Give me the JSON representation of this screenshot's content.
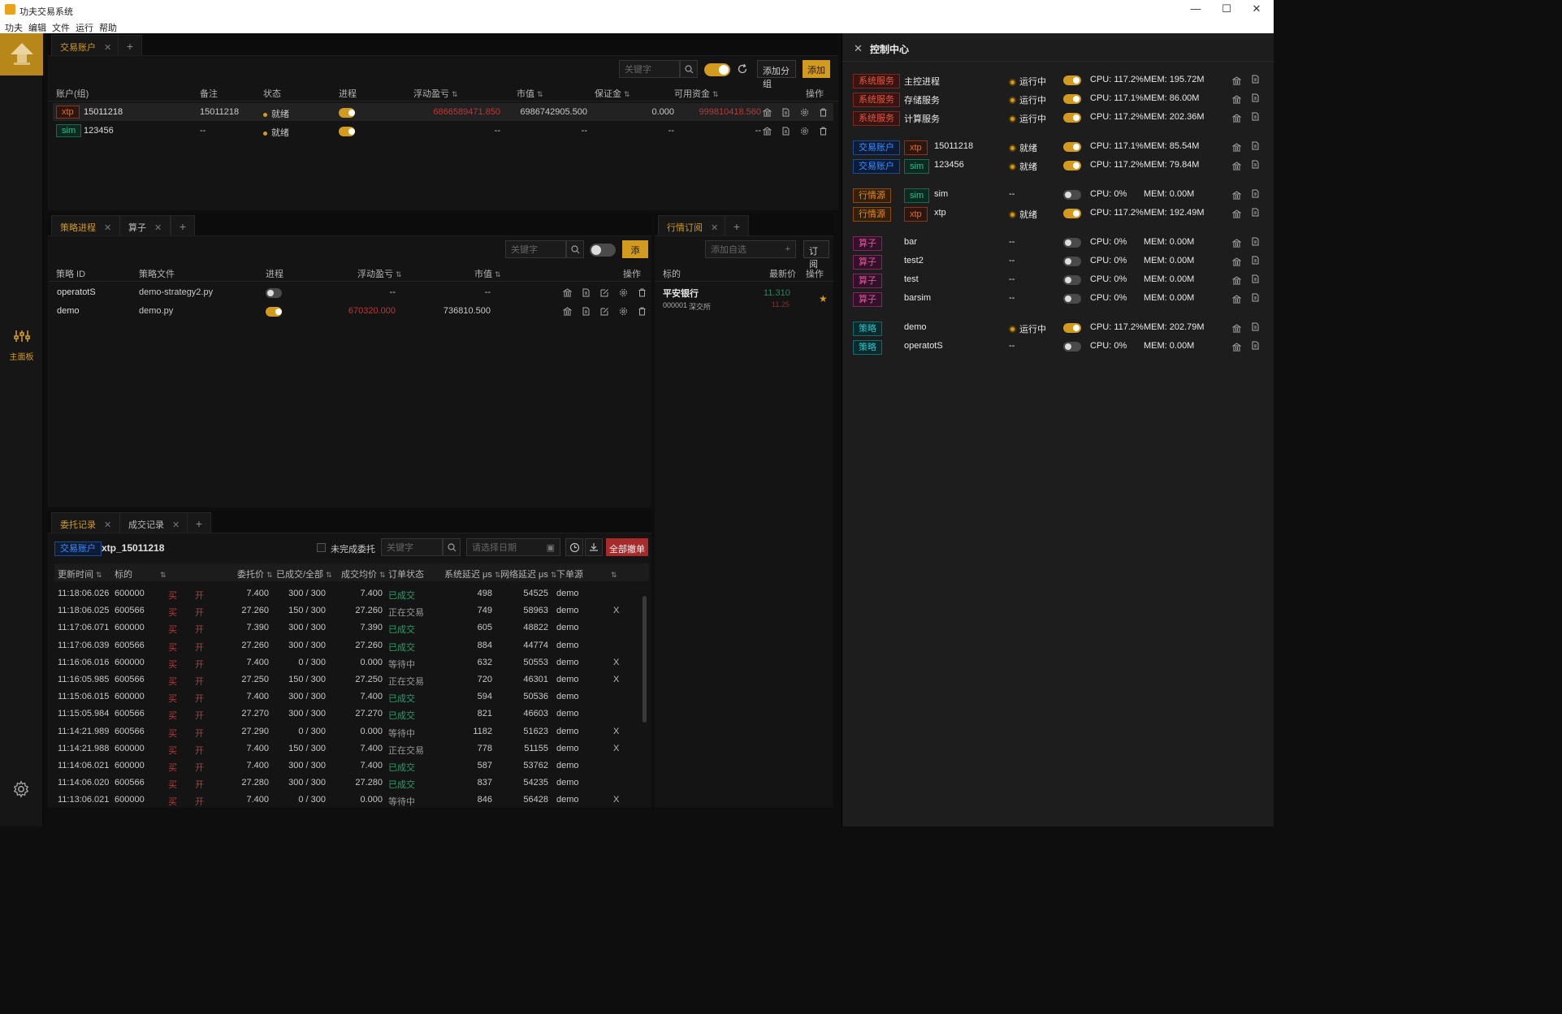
{
  "window": {
    "title": "功夫交易系统",
    "minimize": "—",
    "maximize": "☐",
    "close": "✕"
  },
  "menu": [
    "功夫",
    "编辑",
    "文件",
    "运行",
    "帮助"
  ],
  "sidebar": {
    "main_label": "主面板"
  },
  "accounts_panel": {
    "tabs": [
      {
        "label": "交易账户",
        "close": "✕"
      }
    ],
    "plus": "+",
    "search_placeholder": "关键字",
    "add_group_label": "添加分组",
    "add_label": "添加",
    "columns": [
      "账户(组)",
      "备注",
      "状态",
      "进程",
      "浮动盈亏",
      "市值",
      "保证金",
      "可用资金",
      "操作"
    ],
    "rows": [
      {
        "source": "xtp",
        "account": "15011218",
        "note": "15011218",
        "status": "就绪",
        "process_on": true,
        "float_pnl": "6866589471.850",
        "market_value": "6986742905.500",
        "margin": "0.000",
        "available": "999810418.560"
      },
      {
        "source": "sim",
        "account": "123456",
        "note": "--",
        "status": "就绪",
        "process_on": true,
        "float_pnl": "--",
        "market_value": "--",
        "margin": "--",
        "available": "--"
      }
    ]
  },
  "strategy_panel": {
    "tabs": [
      {
        "label": "策略进程",
        "close": "✕"
      },
      {
        "label": "算子",
        "close": "✕"
      }
    ],
    "plus": "+",
    "search_placeholder": "关键字",
    "add_label": "添加",
    "columns": [
      "策略 ID",
      "策略文件",
      "进程",
      "浮动盈亏",
      "市值",
      "操作"
    ],
    "rows": [
      {
        "id": "operatotS",
        "file": "demo-strategy2.py",
        "process_on": false,
        "float_pnl": "--",
        "market_value": "--"
      },
      {
        "id": "demo",
        "file": "demo.py",
        "process_on": true,
        "float_pnl": "670320.000",
        "market_value": "736810.500"
      }
    ]
  },
  "market_panel": {
    "tabs": [
      {
        "label": "行情订阅",
        "close": "✕"
      }
    ],
    "plus": "+",
    "add_placeholder": "添加自选",
    "subscribe_label": "订阅",
    "columns": [
      "标的",
      "最新价",
      "操作"
    ],
    "rows": [
      {
        "name": "平安银行",
        "code": "000001",
        "exchange": "深交所",
        "last": "11.310",
        "prev": "11.25"
      }
    ]
  },
  "orders_panel": {
    "tabs": [
      {
        "label": "委托记录",
        "close": "✕"
      },
      {
        "label": "成交记录",
        "close": "✕"
      }
    ],
    "plus": "+",
    "account_tag": "交易账户",
    "account_name": "xtp_15011218",
    "unfinished_label": "未完成委托",
    "search_placeholder": "关键字",
    "date_placeholder": "请选择日期",
    "cancel_all_label": "全部撤单",
    "columns": [
      "更新时间",
      "标的",
      "委托价",
      "已成交/全部",
      "成交均价",
      "订单状态",
      "系统延迟 μs",
      "网络延迟 μs",
      "下单源"
    ],
    "rows": [
      {
        "time": "11:18:06.026",
        "code": "600000",
        "side": "买",
        "offset": "开",
        "price": "7.400",
        "filled": "300 / 300",
        "avg": "7.400",
        "status": "已成交",
        "sys": "498",
        "net": "54525",
        "src": "demo",
        "cancel": ""
      },
      {
        "time": "11:18:06.025",
        "code": "600566",
        "side": "买",
        "offset": "开",
        "price": "27.260",
        "filled": "150 / 300",
        "avg": "27.260",
        "status": "正在交易",
        "sys": "749",
        "net": "58963",
        "src": "demo",
        "cancel": "X"
      },
      {
        "time": "11:17:06.071",
        "code": "600000",
        "side": "买",
        "offset": "开",
        "price": "7.390",
        "filled": "300 / 300",
        "avg": "7.390",
        "status": "已成交",
        "sys": "605",
        "net": "48822",
        "src": "demo",
        "cancel": ""
      },
      {
        "time": "11:17:06.039",
        "code": "600566",
        "side": "买",
        "offset": "开",
        "price": "27.260",
        "filled": "300 / 300",
        "avg": "27.260",
        "status": "已成交",
        "sys": "884",
        "net": "44774",
        "src": "demo",
        "cancel": ""
      },
      {
        "time": "11:16:06.016",
        "code": "600000",
        "side": "买",
        "offset": "开",
        "price": "7.400",
        "filled": "0 / 300",
        "avg": "0.000",
        "status": "等待中",
        "sys": "632",
        "net": "50553",
        "src": "demo",
        "cancel": "X"
      },
      {
        "time": "11:16:05.985",
        "code": "600566",
        "side": "买",
        "offset": "开",
        "price": "27.250",
        "filled": "150 / 300",
        "avg": "27.250",
        "status": "正在交易",
        "sys": "720",
        "net": "46301",
        "src": "demo",
        "cancel": "X"
      },
      {
        "time": "11:15:06.015",
        "code": "600000",
        "side": "买",
        "offset": "开",
        "price": "7.400",
        "filled": "300 / 300",
        "avg": "7.400",
        "status": "已成交",
        "sys": "594",
        "net": "50536",
        "src": "demo",
        "cancel": ""
      },
      {
        "time": "11:15:05.984",
        "code": "600566",
        "side": "买",
        "offset": "开",
        "price": "27.270",
        "filled": "300 / 300",
        "avg": "27.270",
        "status": "已成交",
        "sys": "821",
        "net": "46603",
        "src": "demo",
        "cancel": ""
      },
      {
        "time": "11:14:21.989",
        "code": "600566",
        "side": "买",
        "offset": "开",
        "price": "27.290",
        "filled": "0 / 300",
        "avg": "0.000",
        "status": "等待中",
        "sys": "1182",
        "net": "51623",
        "src": "demo",
        "cancel": "X"
      },
      {
        "time": "11:14:21.988",
        "code": "600000",
        "side": "买",
        "offset": "开",
        "price": "7.400",
        "filled": "150 / 300",
        "avg": "7.400",
        "status": "正在交易",
        "sys": "778",
        "net": "51155",
        "src": "demo",
        "cancel": "X"
      },
      {
        "time": "11:14:06.021",
        "code": "600000",
        "side": "买",
        "offset": "开",
        "price": "7.400",
        "filled": "300 / 300",
        "avg": "7.400",
        "status": "已成交",
        "sys": "587",
        "net": "53762",
        "src": "demo",
        "cancel": ""
      },
      {
        "time": "11:14:06.020",
        "code": "600566",
        "side": "买",
        "offset": "开",
        "price": "27.280",
        "filled": "300 / 300",
        "avg": "27.280",
        "status": "已成交",
        "sys": "837",
        "net": "54235",
        "src": "demo",
        "cancel": ""
      },
      {
        "time": "11:13:06.021",
        "code": "600000",
        "side": "买",
        "offset": "开",
        "price": "7.400",
        "filled": "0 / 300",
        "avg": "0.000",
        "status": "等待中",
        "sys": "846",
        "net": "56428",
        "src": "demo",
        "cancel": "X"
      }
    ]
  },
  "control_center": {
    "title": "控制中心",
    "close": "✕",
    "rows": [
      {
        "group": 0,
        "tag": "系统服务",
        "tag_class": "tag-sys",
        "src": "",
        "name": "主控进程",
        "status": "运行中",
        "on": true,
        "cpu": "CPU: 117.2%",
        "mem": "MEM: 195.72M"
      },
      {
        "group": 0,
        "tag": "系统服务",
        "tag_class": "tag-sys",
        "src": "",
        "name": "存储服务",
        "status": "运行中",
        "on": true,
        "cpu": "CPU: 117.1%",
        "mem": "MEM: 86.00M"
      },
      {
        "group": 0,
        "tag": "系统服务",
        "tag_class": "tag-sys",
        "src": "",
        "name": "计算服务",
        "status": "运行中",
        "on": true,
        "cpu": "CPU: 117.2%",
        "mem": "MEM: 202.36M"
      },
      {
        "group": 1,
        "tag": "交易账户",
        "tag_class": "tag-blue",
        "src": "xtp",
        "name": "15011218",
        "status": "就绪",
        "on": true,
        "cpu": "CPU: 117.1%",
        "mem": "MEM: 85.54M"
      },
      {
        "group": 1,
        "tag": "交易账户",
        "tag_class": "tag-blue",
        "src": "sim",
        "name": "123456",
        "status": "就绪",
        "on": true,
        "cpu": "CPU: 117.2%",
        "mem": "MEM: 79.84M"
      },
      {
        "group": 2,
        "tag": "行情源",
        "tag_class": "tag-md",
        "src": "sim",
        "name": "sim",
        "status": "--",
        "on": false,
        "cpu": "CPU: 0%",
        "mem": "MEM: 0.00M"
      },
      {
        "group": 2,
        "tag": "行情源",
        "tag_class": "tag-md",
        "src": "xtp",
        "name": "xtp",
        "status": "就绪",
        "on": true,
        "cpu": "CPU: 117.2%",
        "mem": "MEM: 192.49M"
      },
      {
        "group": 3,
        "tag": "算子",
        "tag_class": "tag-calc",
        "src": "",
        "name": "bar",
        "status": "--",
        "on": false,
        "cpu": "CPU: 0%",
        "mem": "MEM: 0.00M"
      },
      {
        "group": 3,
        "tag": "算子",
        "tag_class": "tag-calc",
        "src": "",
        "name": "test2",
        "status": "--",
        "on": false,
        "cpu": "CPU: 0%",
        "mem": "MEM: 0.00M"
      },
      {
        "group": 3,
        "tag": "算子",
        "tag_class": "tag-calc",
        "src": "",
        "name": "test",
        "status": "--",
        "on": false,
        "cpu": "CPU: 0%",
        "mem": "MEM: 0.00M"
      },
      {
        "group": 3,
        "tag": "算子",
        "tag_class": "tag-calc",
        "src": "",
        "name": "barsim",
        "status": "--",
        "on": false,
        "cpu": "CPU: 0%",
        "mem": "MEM: 0.00M"
      },
      {
        "group": 4,
        "tag": "策略",
        "tag_class": "tag-strat",
        "src": "",
        "name": "demo",
        "status": "运行中",
        "on": true,
        "cpu": "CPU: 117.2%",
        "mem": "MEM: 202.79M"
      },
      {
        "group": 4,
        "tag": "策略",
        "tag_class": "tag-strat",
        "src": "",
        "name": "operatotS",
        "status": "--",
        "on": false,
        "cpu": "CPU: 0%",
        "mem": "MEM: 0.00M"
      }
    ]
  },
  "colors": {
    "accent": "#d29a1e",
    "loss": "#b83939",
    "gain": "#22a06b"
  }
}
